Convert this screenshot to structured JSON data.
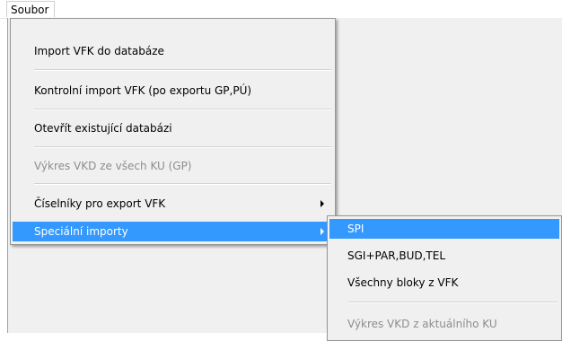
{
  "menubar": {
    "file_label": "Soubor"
  },
  "file_menu": {
    "import_vfk": "Import VFK do databáze",
    "control_import": "Kontrolní import VFK (po exportu GP,PÚ)",
    "open_db": "Otevřít existující databázi",
    "vkd_all": "Výkres VKD ze všech KU (GP)",
    "codelists": "Číselníky pro export VFK",
    "special_imports": "Speciální importy"
  },
  "special_menu": {
    "spi": "SPI",
    "sgi": "SGI+PAR,BUD,TEL",
    "all_blocks": "Všechny bloky z VFK",
    "vkd_current": "Výkres VKD z aktuálního  KU"
  },
  "colors": {
    "highlight": "#3399ff",
    "menu_bg": "#f0f0f0",
    "disabled_text": "#8d8d8d"
  },
  "icons": {
    "submenu_arrow": "triangle-right-icon"
  }
}
